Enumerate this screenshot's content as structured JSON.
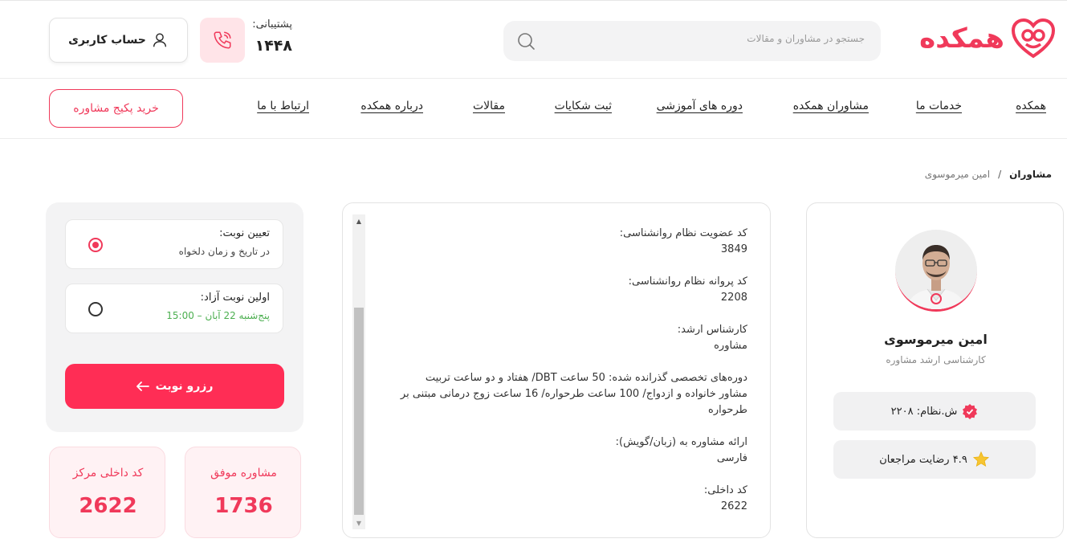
{
  "header": {
    "brand": "همکده",
    "search_placeholder": "جستجو در مشاوران و مقالات",
    "support_label": "پشتیبانی:",
    "support_number": "۱۴۴۸",
    "account_label": "حساب کاربری"
  },
  "nav": {
    "items": [
      "همکده",
      "خدمات ما",
      "مشاوران همکده",
      "دوره های آموزشی",
      "ثبت شکایات",
      "مقالات",
      "درباره همکده",
      "ارتباط با ما"
    ],
    "buy_button": "خرید پکیج مشاوره"
  },
  "breadcrumb": [
    "مشاوران",
    "/",
    "امین میرموسوی"
  ],
  "profile": {
    "name": "امین میرموسوی",
    "title": "کارشناسی ارشد مشاوره",
    "license_badge": "ش.نظام: ۲۲۰۸",
    "rating_badge": "۴.۹ رضایت مراجعان"
  },
  "details": [
    {
      "label": "کد عضویت نظام روانشناسی:",
      "value": "3849"
    },
    {
      "label": "کد پروانه نظام روانشناسی:",
      "value": "2208"
    },
    {
      "label": "کارشناس ارشد:",
      "value": "مشاوره"
    },
    {
      "label": "دوره‌های تخصصی گذرانده شده: 50 ساعت DBT/ هفتاد و دو ساعت تربیت مشاور خانواده و ازدواج/ 100 ساعت طرحواره/ 16 ساعت زوج درمانی مبتنی بر طرحواره",
      "value": ""
    },
    {
      "label": "ارائه مشاوره به (زبان/گویش):",
      "value": "فارسی"
    },
    {
      "label": "کد داخلی:",
      "value": "2622"
    }
  ],
  "booking": {
    "option1_title": "تعیین نوبت:",
    "option1_sub": "در تاریخ و زمان دلخواه",
    "option2_title": "اولین نوبت آزاد:",
    "option2_sub": "پنج‌شنبه 22 آبان – 15:00",
    "reserve_label": "رزرو نوبت",
    "selected_option": 1
  },
  "stats": [
    {
      "label": "مشاوره موفق",
      "value": "1736"
    },
    {
      "label": "کد داخلی مرکز",
      "value": "2622"
    }
  ],
  "colors": {
    "accent": "#f0395a",
    "button": "#ff2d55",
    "soft_pink": "#fff2f4",
    "success": "#4caf50"
  },
  "icons": [
    "logo-heart-icon",
    "search-icon",
    "phone-icon",
    "user-icon",
    "verified-icon",
    "star-icon",
    "arrow-left-icon"
  ]
}
